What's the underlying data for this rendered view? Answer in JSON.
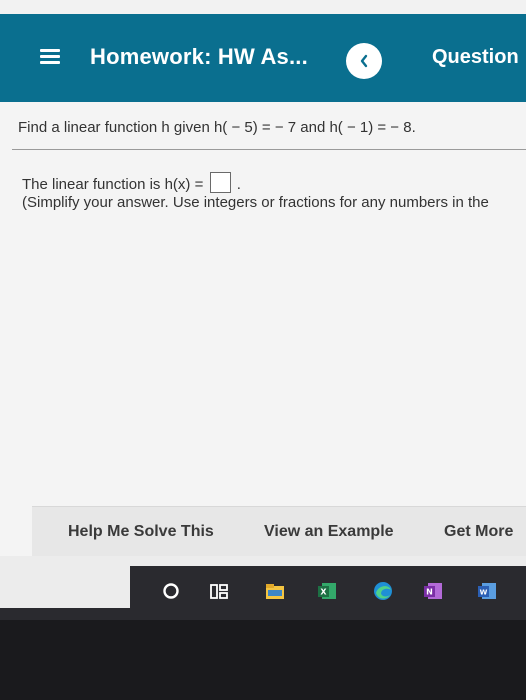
{
  "header": {
    "title": "Homework: HW As...",
    "right_label": "Question"
  },
  "question": {
    "prompt": "Find a linear function h given h( − 5) = − 7 and h( − 1) = − 8.",
    "answer_prefix": "The linear function is h(x) =",
    "answer_suffix": ".",
    "hint": "(Simplify your answer. Use integers or fractions for any numbers in the"
  },
  "actions": {
    "help": "Help Me Solve This",
    "example": "View an Example",
    "more": "Get More"
  },
  "taskbar": {
    "excel_letter": "X",
    "onenote_letter": "N",
    "word_letter": "W"
  },
  "colors": {
    "header": "#0a6f8f",
    "content_bg": "#f4f4f4",
    "taskbar": "#2a2a2f"
  }
}
